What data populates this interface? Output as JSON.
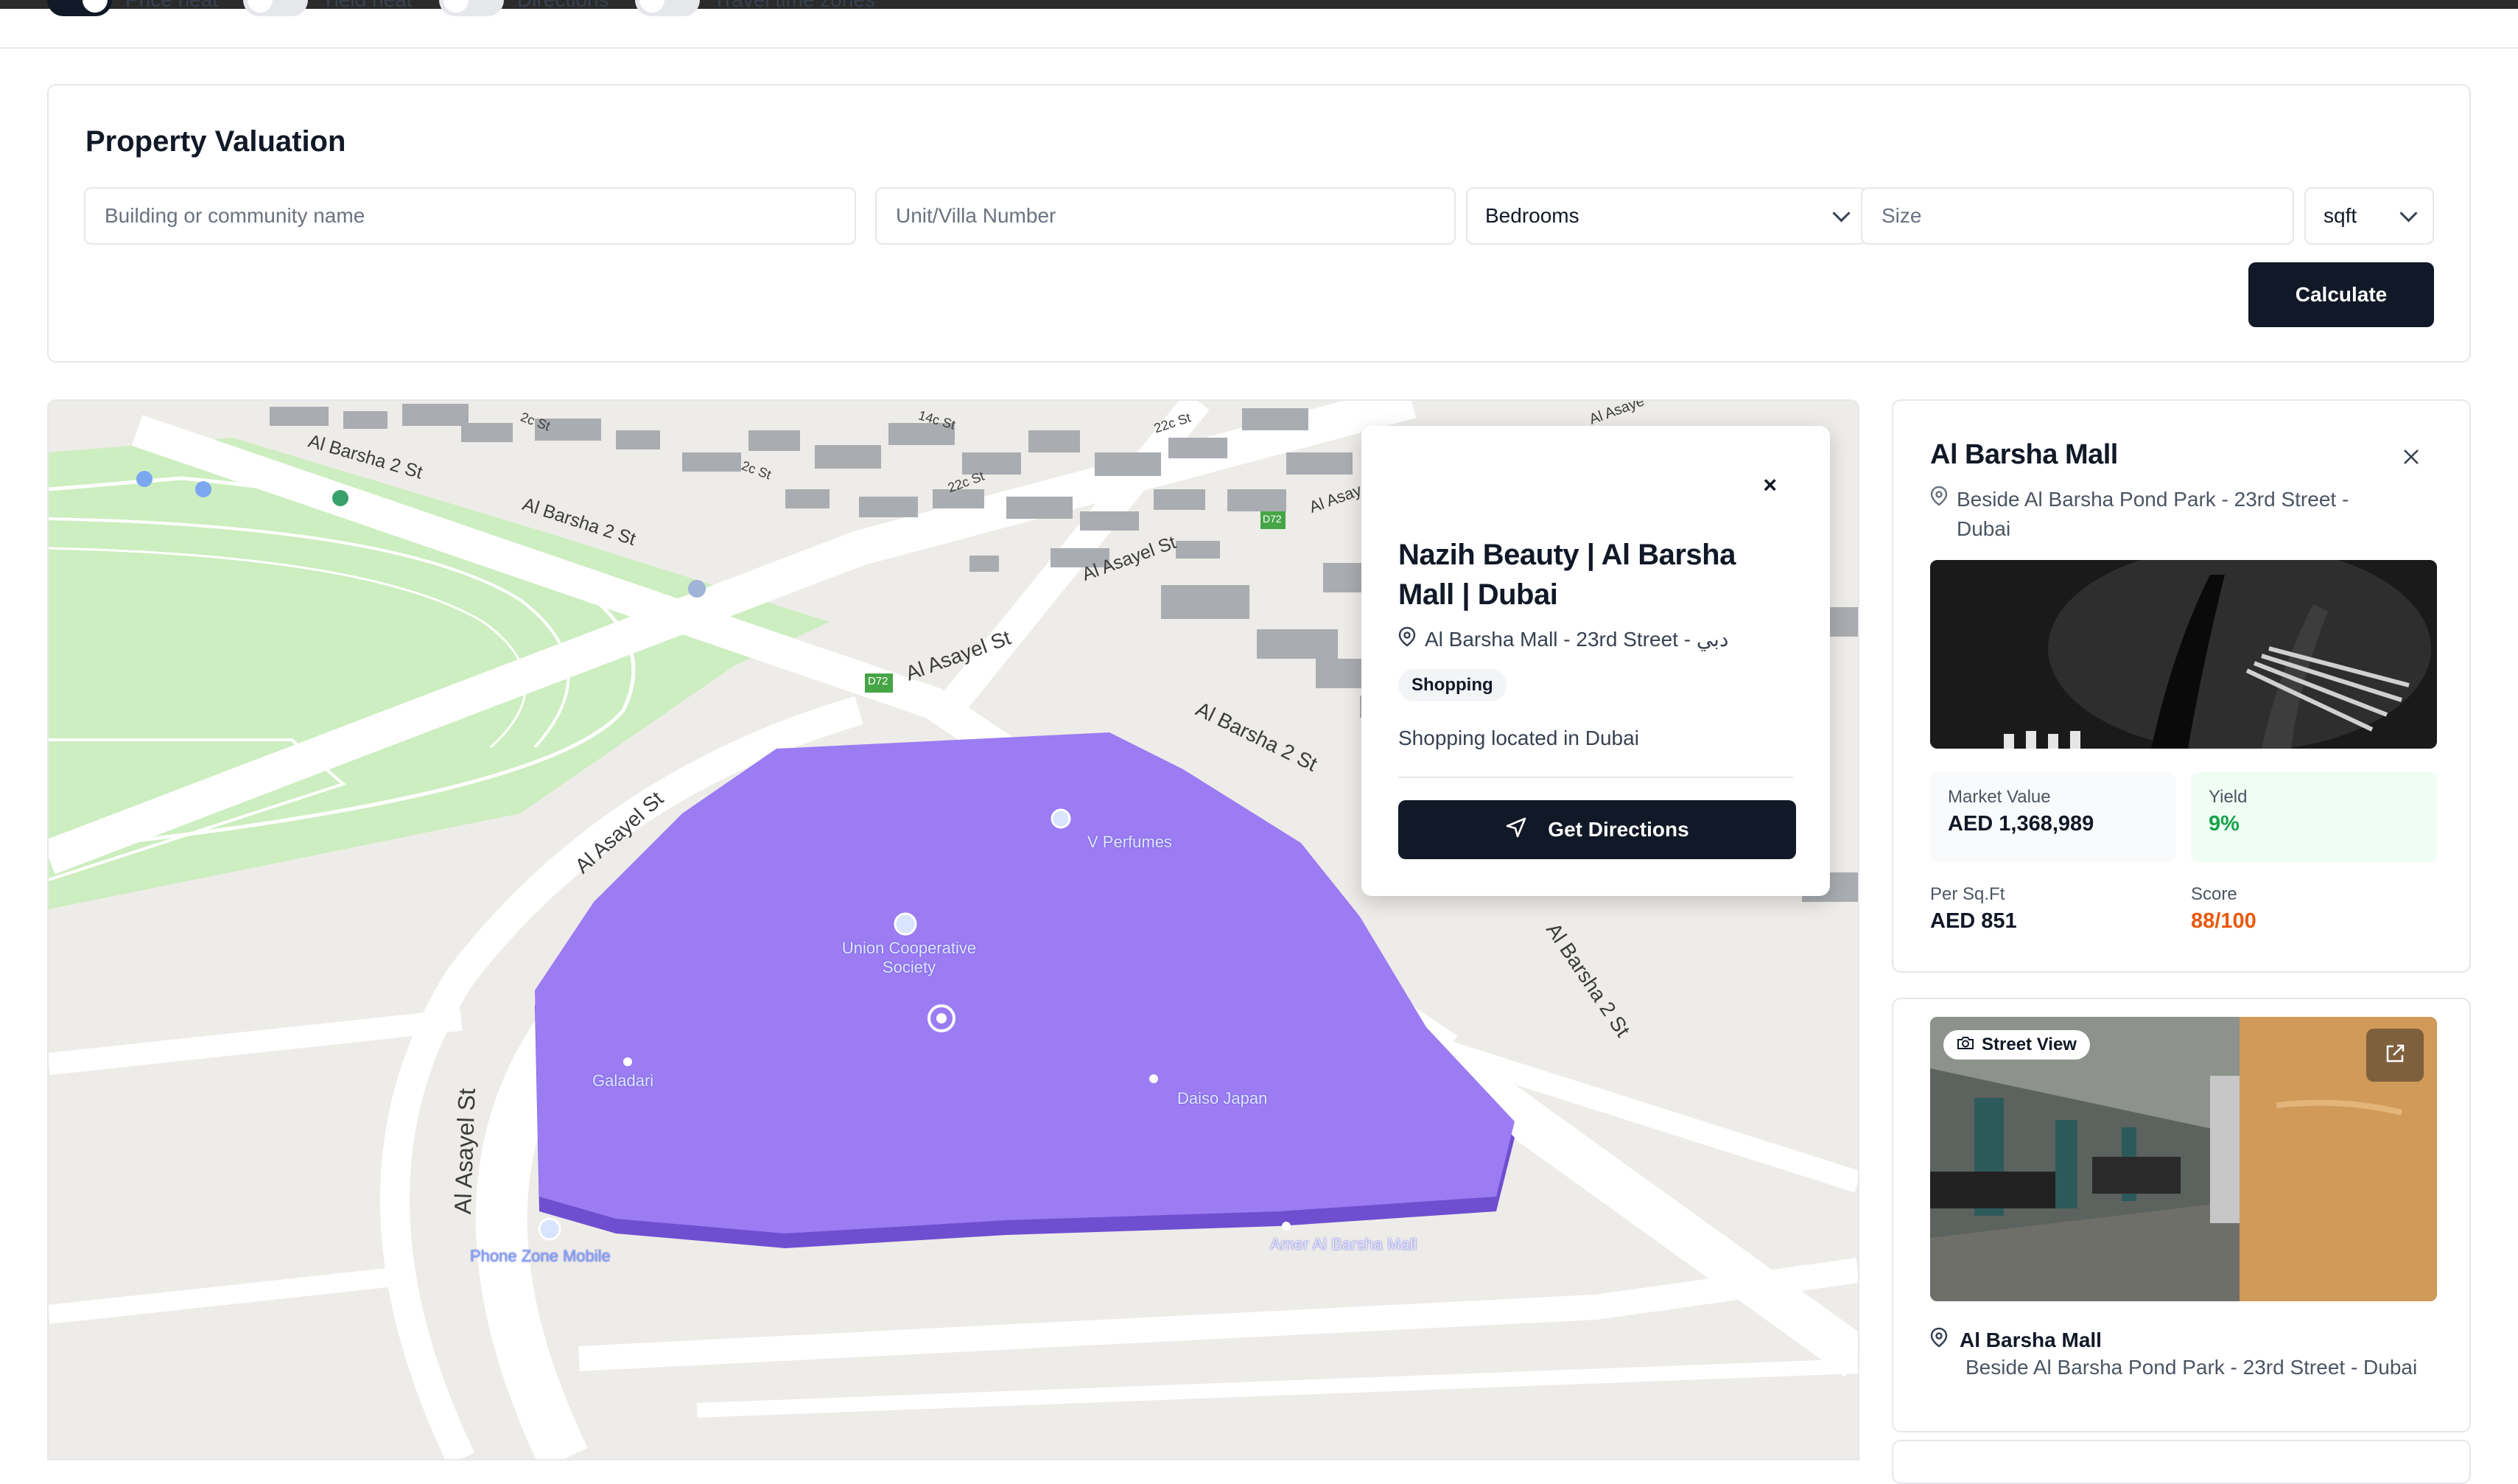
{
  "layers": {
    "toggles": [
      {
        "label": "Price heat",
        "on": true
      },
      {
        "label": "Yield heat",
        "on": false
      },
      {
        "label": "Directions",
        "on": false
      },
      {
        "label": "Travel time zones",
        "on": false
      }
    ]
  },
  "valuation": {
    "title": "Property Valuation",
    "building_placeholder": "Building or community name",
    "unit_placeholder": "Unit/Villa Number",
    "bedrooms_value": "Bedrooms",
    "size_placeholder": "Size",
    "unit_select_value": "sqft",
    "calculate_label": "Calculate"
  },
  "map": {
    "streets": [
      "Al Barsha 2 St",
      "Al Barsha 2 St",
      "Al Asayel St",
      "Al Asayel St",
      "Al Asayel St",
      "Al Barsha 2 St",
      "Al Barsha 2 St",
      "Al Asayel St",
      "2c St",
      "2c St",
      "22c St",
      "14c St",
      "22c St",
      "Al Asay",
      "Al Asaye"
    ],
    "road_badges": [
      "D72",
      "D72"
    ],
    "pois": [
      "V Perfumes",
      "Union Cooperative Society",
      "Galadari",
      "Daiso Japan",
      "Phone Zone Mobile",
      "Amer Al Barsha Mall"
    ]
  },
  "popup": {
    "close": "×",
    "title": "Nazih Beauty | Al Barsha Mall | Dubai",
    "address": "Al Barsha Mall - 23rd Street - دبي",
    "tag": "Shopping",
    "description": "Shopping located in Dubai",
    "directions_label": "Get Directions"
  },
  "property": {
    "title": "Al Barsha Mall",
    "address": "Beside Al Barsha Pond Park - 23rd Street - Dubai",
    "market_value_label": "Market Value",
    "market_value": "AED 1,368,989",
    "yield_label": "Yield",
    "yield": "9%",
    "per_sqft_label": "Per Sq.Ft",
    "per_sqft": "AED 851",
    "score_label": "Score",
    "score": "88/100"
  },
  "street_view": {
    "badge": "Street View",
    "name": "Al Barsha Mall",
    "address": "Beside Al Barsha Pond Park - 23rd Street - Dubai"
  },
  "colors": {
    "primary": "#111827",
    "mall_polygon": "#9b7cf2",
    "park": "#cdeec0",
    "yield_green": "#16a34a",
    "score_orange": "#ea580c"
  }
}
